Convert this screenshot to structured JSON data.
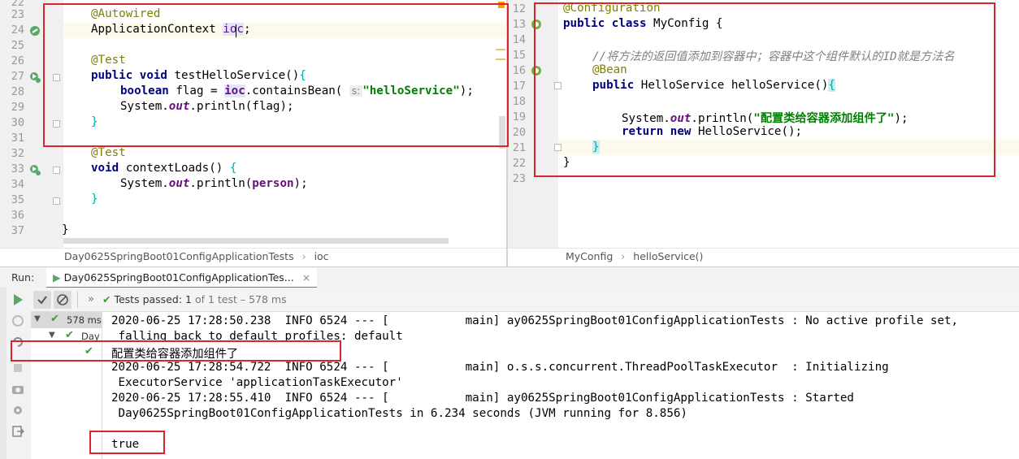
{
  "left_editor": {
    "line_numbers": [
      "22",
      "23",
      "24",
      "25",
      "26",
      "27",
      "28",
      "29",
      "30",
      "31",
      "32",
      "33",
      "34",
      "35",
      "36",
      "37"
    ],
    "lines": {
      "l23": "@Autowired",
      "l24_type": "ApplicationContext ",
      "l24_var_a": "i",
      "l24_var_b": "oc",
      "l24_end": ";",
      "l26": "@Test",
      "l27_kw": "public void ",
      "l27_rest": "testHelloService()",
      "l27_brace": "{",
      "l28_kw": "boolean ",
      "l28_a": "flag = ",
      "l28_ioc": "ioc",
      "l28_b": ".containsBean( ",
      "l28_hint": "s:",
      "l28_str": "\"helloService\"",
      "l28_end": ");",
      "l29_a": "System.",
      "l29_out": "out",
      "l29_b": ".println(flag);",
      "l30": "}",
      "l32": "@Test",
      "l33_kw": "void ",
      "l33_rest": "contextLoads() ",
      "l33_brace": "{",
      "l34_a": "System.",
      "l34_out": "out",
      "l34_b": ".println(",
      "l34_person": "person",
      "l34_c": ");",
      "l35": "}",
      "l37": "}"
    },
    "breadcrumb": [
      "Day0625SpringBoot01ConfigApplicationTests",
      "ioc"
    ]
  },
  "right_editor": {
    "line_numbers": [
      "12",
      "13",
      "14",
      "15",
      "16",
      "17",
      "18",
      "19",
      "20",
      "21",
      "22",
      "23"
    ],
    "lines": {
      "l12": "@Configuration",
      "l13_kw": "public class ",
      "l13_rest": "MyConfig {",
      "l15": "//将方法的返回值添加到容器中；容器中这个组件默认的ID就是方法名",
      "l16": "@Bean",
      "l17_kw": "public ",
      "l17_rest": "HelloService helloService()",
      "l17_brace": "{",
      "l19_a": "System.",
      "l19_out": "out",
      "l19_b": ".println(",
      "l19_str": "\"配置类给容器添加组件了\"",
      "l19_c": ");",
      "l20_kw1": "return new ",
      "l20_rest": "HelloService();",
      "l21": "}",
      "l22": "}"
    },
    "breadcrumb": [
      "MyConfig",
      "helloService()"
    ]
  },
  "run_panel": {
    "label": "Run:",
    "tab_title": "Day0625SpringBoot01ConfigApplicationTes...",
    "tab_close": "×",
    "status_prefix": "Tests passed:",
    "status_count": "1",
    "status_suffix": "of 1 test – 578 ms",
    "tree_time": "578 ms",
    "tree_item": "Day"
  },
  "console": {
    "lines": [
      "2020-06-25 17:28:50.238  INFO 6524 --- [           main] ay0625SpringBoot01ConfigApplicationTests : No active profile set,",
      " falling back to default profiles: default",
      "配置类给容器添加组件了",
      "2020-06-25 17:28:54.722  INFO 6524 --- [           main] o.s.s.concurrent.ThreadPoolTaskExecutor  : Initializing",
      " ExecutorService 'applicationTaskExecutor'",
      "2020-06-25 17:28:55.410  INFO 6524 --- [           main] ay0625SpringBoot01ConfigApplicationTests : Started",
      " Day0625SpringBoot01ConfigApplicationTests in 6.234 seconds (JVM running for 8.856)",
      "",
      "true"
    ]
  },
  "colors": {
    "annotation_box": "#d9262e",
    "keyword": "#000080",
    "string": "#008000",
    "annotation": "#808000",
    "static_field": "#660e7a",
    "comment": "#808080",
    "pass_green": "#3c9a3c"
  }
}
